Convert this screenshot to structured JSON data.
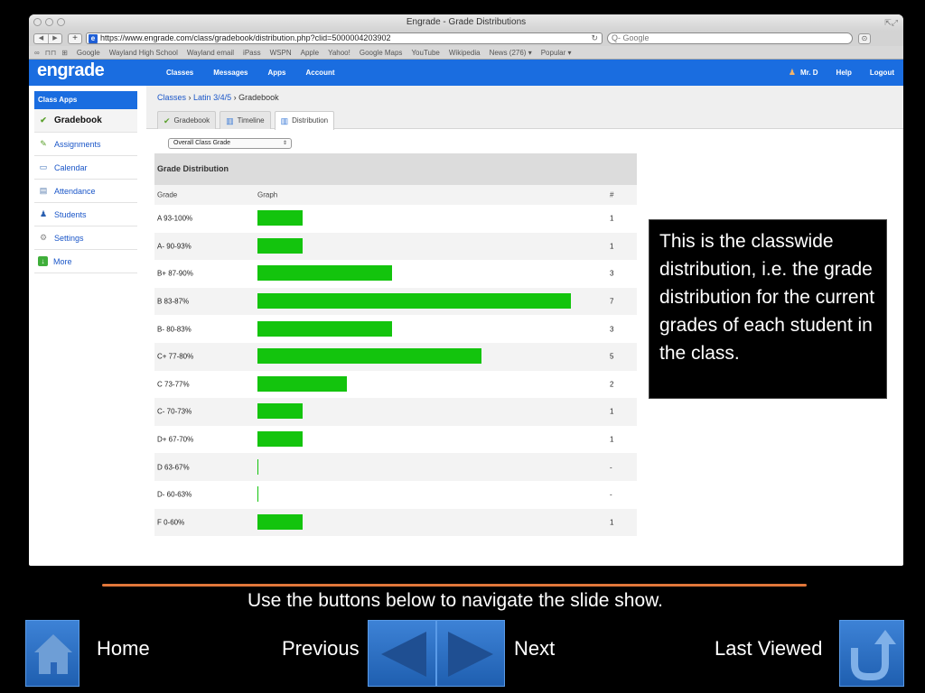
{
  "browser": {
    "window_title": "Engrade - Grade Distributions",
    "url": "https://www.engrade.com/class/gradebook/distribution.php?clid=5000004203902",
    "search_placeholder": "Q- Google",
    "bookmarks": [
      "Google",
      "Wayland High School",
      "Wayland email",
      "iPass",
      "WSPN",
      "Apple",
      "Yahoo!",
      "Google Maps",
      "YouTube",
      "Wikipedia",
      "News (276) ▾",
      "Popular ▾"
    ]
  },
  "site": {
    "logo": "engrade",
    "nav": [
      "Classes",
      "Messages",
      "Apps",
      "Account"
    ],
    "user": "Mr. D",
    "help": "Help",
    "logout": "Logout"
  },
  "breadcrumb": {
    "classes": "Classes",
    "sep": "›",
    "course": "Latin 3/4/5",
    "current": "Gradebook"
  },
  "tabs": [
    "Gradebook",
    "Timeline",
    "Distribution"
  ],
  "sidebar": {
    "header": "Class Apps",
    "items": [
      "Gradebook",
      "Assignments",
      "Calendar",
      "Attendance",
      "Students",
      "Settings",
      "More"
    ]
  },
  "select": {
    "value": "Overall Class Grade"
  },
  "table": {
    "title": "Grade Distribution",
    "col_grade": "Grade",
    "col_graph": "Graph",
    "col_count": "#"
  },
  "chart_data": {
    "type": "bar",
    "title": "Grade Distribution",
    "categories": [
      "A 93-100%",
      "A- 90-93%",
      "B+ 87-90%",
      "B 83-87%",
      "B- 80-83%",
      "C+ 77-80%",
      "C 73-77%",
      "C- 70-73%",
      "D+ 67-70%",
      "D 63-67%",
      "D- 60-63%",
      "F 0-60%"
    ],
    "values": [
      1,
      1,
      3,
      7,
      3,
      5,
      2,
      1,
      1,
      0,
      0,
      1
    ],
    "labels": [
      "1",
      "1",
      "3",
      "7",
      "3",
      "5",
      "2",
      "1",
      "1",
      "-",
      "-",
      "1"
    ],
    "bar_color": "#13c40d",
    "max": 7
  },
  "callout": "This is the classwide distribution, i.e. the grade distribution for the current grades of each student in the class.",
  "slide_nav": {
    "instruction": "Use the buttons below to navigate the slide show.",
    "home": "Home",
    "previous": "Previous",
    "next": "Next",
    "last_viewed": "Last Viewed"
  },
  "colors": {
    "header_blue": "#1a6de0",
    "link_blue": "#1a56c8",
    "accent_orange": "#e2773a",
    "button_blue": "#2f71c6"
  }
}
